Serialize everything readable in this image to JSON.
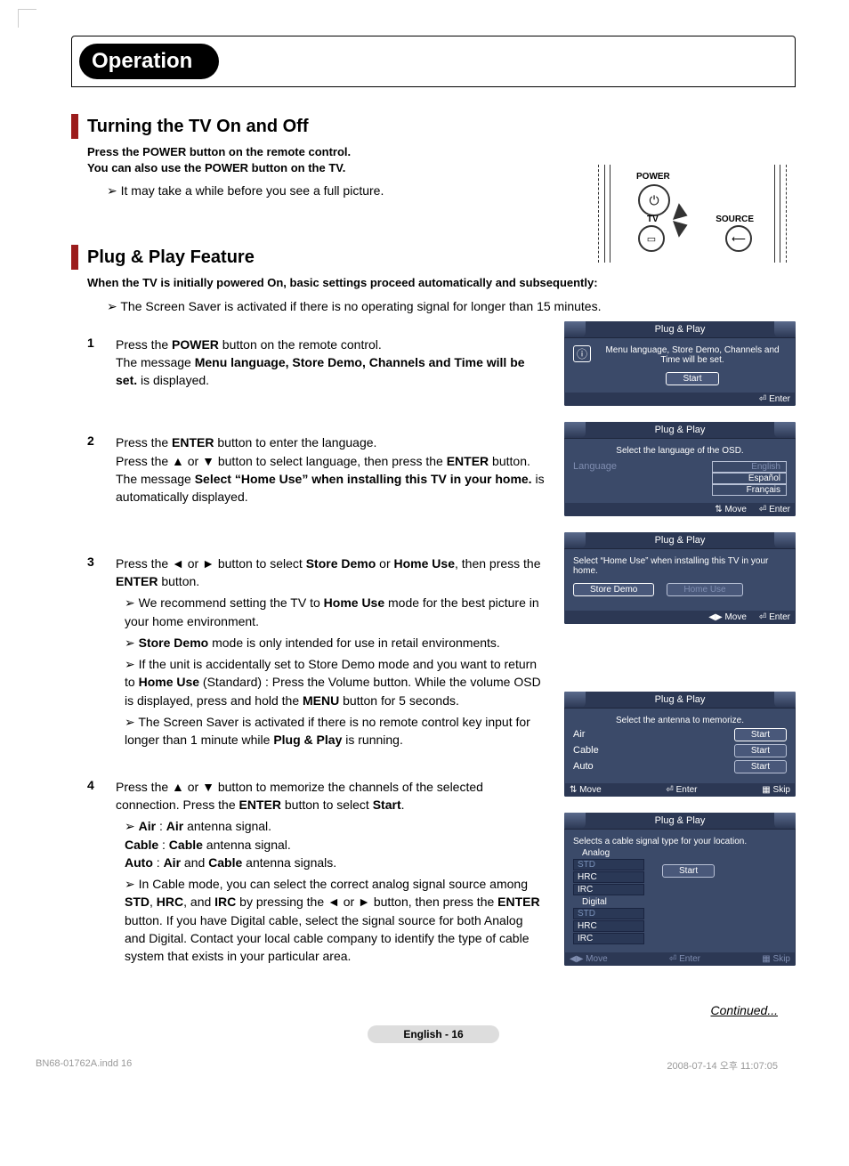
{
  "header": {
    "title": "Operation"
  },
  "section1": {
    "title": "Turning the TV On and Off",
    "lead1": "Press the POWER button on the remote control.",
    "lead2": "You can also use the POWER button on the TV.",
    "note1": "It may take a while before you see a full picture."
  },
  "tvpanel": {
    "power": "POWER",
    "tv": "TV",
    "source": "SOURCE"
  },
  "section2": {
    "title": "Plug & Play Feature",
    "lead": "When the TV is initially powered On, basic settings proceed automatically and subsequently:",
    "saver": "The Screen Saver is activated if there is no operating signal for longer than 15 minutes."
  },
  "steps": {
    "s1": {
      "a": "Press the ",
      "b": "POWER",
      "c": " button on the remote control.",
      "d": "The message ",
      "e": "Menu language, Store Demo, Channels and Time will be set.",
      "f": " is displayed."
    },
    "s2": {
      "a": "Press the ",
      "b": "ENTER",
      "c": " button to enter the language.",
      "d": "Press the ▲ or ▼ button to select language, then press the ",
      "e": "ENTER",
      "f": " button. The message ",
      "g": "Select “Home Use” when installing this TV in your home.",
      "h": " is automatically displayed."
    },
    "s3": {
      "a": "Press the ◄ or ► button to select ",
      "b": "Store Demo",
      "c": " or ",
      "d": "Home Use",
      "e": ", then press the ",
      "f": "ENTER",
      "g": " button.",
      "sub": {
        "i": "We recommend setting the TV to Home Use mode for the best picture in your home environment.",
        "ii": "Store Demo mode is only intended for use in retail environments.",
        "iii": "If the unit is accidentally set to Store Demo mode and you want to return to Home Use (Standard) : Press the Volume button. While the volume OSD is displayed, press and hold the MENU button for 5 seconds.",
        "iv": "The Screen Saver is activated if there is no remote control key input for longer than 1 minute while Plug & Play is running."
      }
    },
    "s4": {
      "a": "Press the ▲ or ▼ button to memorize the channels of the selected connection. Press the ",
      "b": "ENTER",
      "c": " button to select ",
      "d": "Start",
      "e": ".",
      "sub": {
        "i": "Air : Air antenna signal.\nCable : Cable antenna signal.\nAuto : Air and Cable antenna signals.",
        "ii": "In Cable mode, you can select the correct analog signal source among STD, HRC, and IRC by pressing the ◄ or ► button, then press the ENTER button. If you have Digital cable, select the signal source for both Analog and Digital. Contact your local cable company to identify the type of cable system that exists in your particular area."
      }
    }
  },
  "osd": {
    "title": "Plug & Play",
    "enter": "Enter",
    "move": "Move",
    "skip": "Skip",
    "screen1": {
      "msg": "Menu language, Store Demo, Channels and Time will be set.",
      "start": "Start"
    },
    "screen2": {
      "msg": "Select the language of the OSD.",
      "label": "Language",
      "opts": [
        "English",
        "Español",
        "Français"
      ]
    },
    "screen3": {
      "msg": "Select “Home Use” when installing this TV in your home.",
      "left": "Store Demo",
      "right": "Home Use"
    },
    "screen4": {
      "msg": "Select the antenna to memorize.",
      "rows": [
        "Air",
        "Cable",
        "Auto"
      ],
      "start": "Start"
    },
    "screen5": {
      "msg": "Selects a cable signal type for your location.",
      "analog": "Analog",
      "digital": "Digital",
      "std": "STD",
      "hrc": "HRC",
      "irc": "IRC",
      "start": "Start"
    }
  },
  "continued": "Continued...",
  "pagefoot": "English - 16",
  "print": {
    "file": "BN68-01762A.indd   16",
    "time": "2008-07-14   오후 11:07:05"
  }
}
